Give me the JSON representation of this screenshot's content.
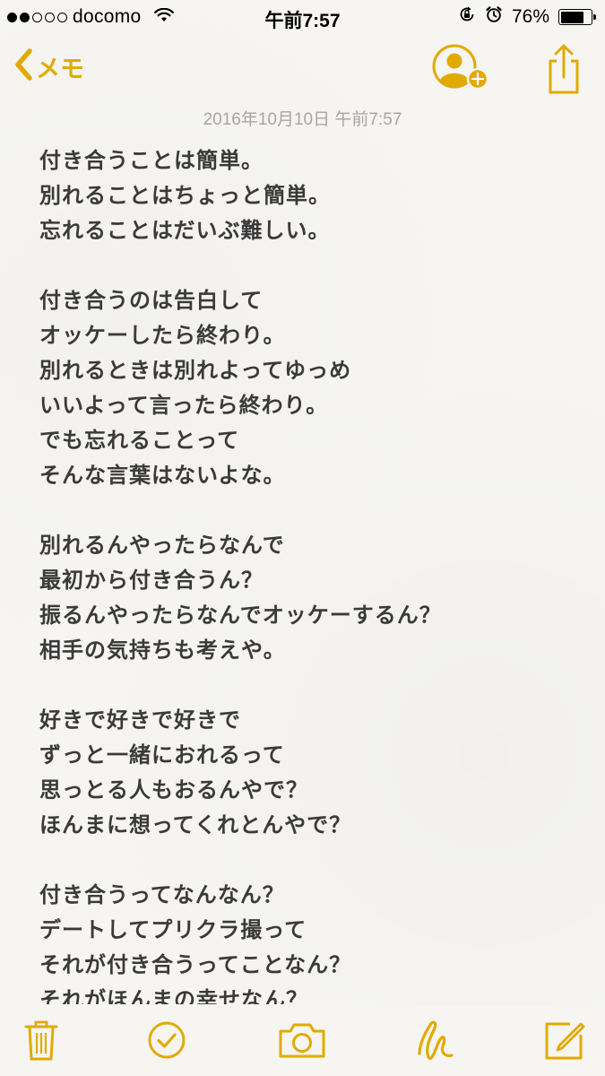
{
  "status_bar": {
    "carrier": "docomo",
    "time": "午前7:57",
    "battery_percent": "76%",
    "battery_level": 0.76,
    "signal_bars_filled": 2,
    "signal_bars_total": 5
  },
  "nav": {
    "back_label": "メモ",
    "accent_color": "#e1aa00"
  },
  "note": {
    "date": "2016年10月10日 午前7:57",
    "lines": [
      "付き合うことは簡単。",
      "別れることはちょっと簡単。",
      "忘れることはだいぶ難しい。",
      "",
      "付き合うのは告白して",
      "オッケーしたら終わり。",
      "別れるときは別れよってゆっめ",
      "いいよって言ったら終わり。",
      "でも忘れることって",
      "そんな言葉はないよな。",
      "",
      "別れるんやったらなんで",
      "最初から付き合うん？",
      "振るんやったらなんでオッケーするん？",
      "相手の気持ちも考えや。",
      "",
      "好きで好きで好きで",
      "ずっと一緒におれるって",
      "思っとる人もおるんやで？",
      "ほんまに想ってくれとんやで？",
      "",
      "付き合うってなんなん？",
      "デートしてプリクラ撮って",
      "それが付き合うってことなん？",
      "それがほんまの幸せなん？"
    ]
  },
  "toolbar": {
    "icons": [
      "trash-icon",
      "checklist-icon",
      "camera-icon",
      "sketch-icon",
      "compose-icon"
    ]
  }
}
